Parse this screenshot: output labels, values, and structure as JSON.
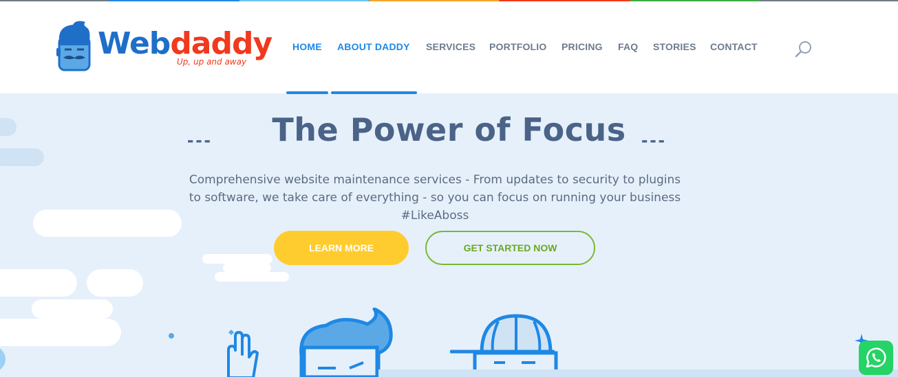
{
  "colors": {
    "brand_blue": "#1f6fc8",
    "brand_red": "#f0391d",
    "nav_active": "#1e88e5",
    "nav_default": "#6d7b8c",
    "hero_bg": "#e6f0fb",
    "title": "#4a6387",
    "button_yellow": "#ffcc2f",
    "button_green": "#7ab82e",
    "whatsapp_green": "#25d366"
  },
  "logo": {
    "part1": "Web",
    "part2": "daddy",
    "tagline": "Up, up and away",
    "icon": "daddy-mascot-icon"
  },
  "nav": {
    "items": [
      {
        "label": "HOME",
        "active": true
      },
      {
        "label": "ABOUT DADDY",
        "active": true
      },
      {
        "label": "SERVICES",
        "active": false
      },
      {
        "label": "PORTFOLIO",
        "active": false
      },
      {
        "label": "PRICING",
        "active": false
      },
      {
        "label": "FAQ",
        "active": false
      },
      {
        "label": "STORIES",
        "active": false
      },
      {
        "label": "CONTACT",
        "active": false
      }
    ],
    "search_icon": "search-icon"
  },
  "hero": {
    "title": "The Power of Focus",
    "dash_left": "---",
    "dash_right": "---",
    "subtitle": "Comprehensive website maintenance services - From updates to security to plugins to software, we take care of everything - so you can focus on running your business #LikeAboss",
    "learn_more": "LEARN MORE",
    "get_started": "GET STARTED NOW"
  },
  "widgets": {
    "whatsapp_icon": "whatsapp-icon"
  }
}
